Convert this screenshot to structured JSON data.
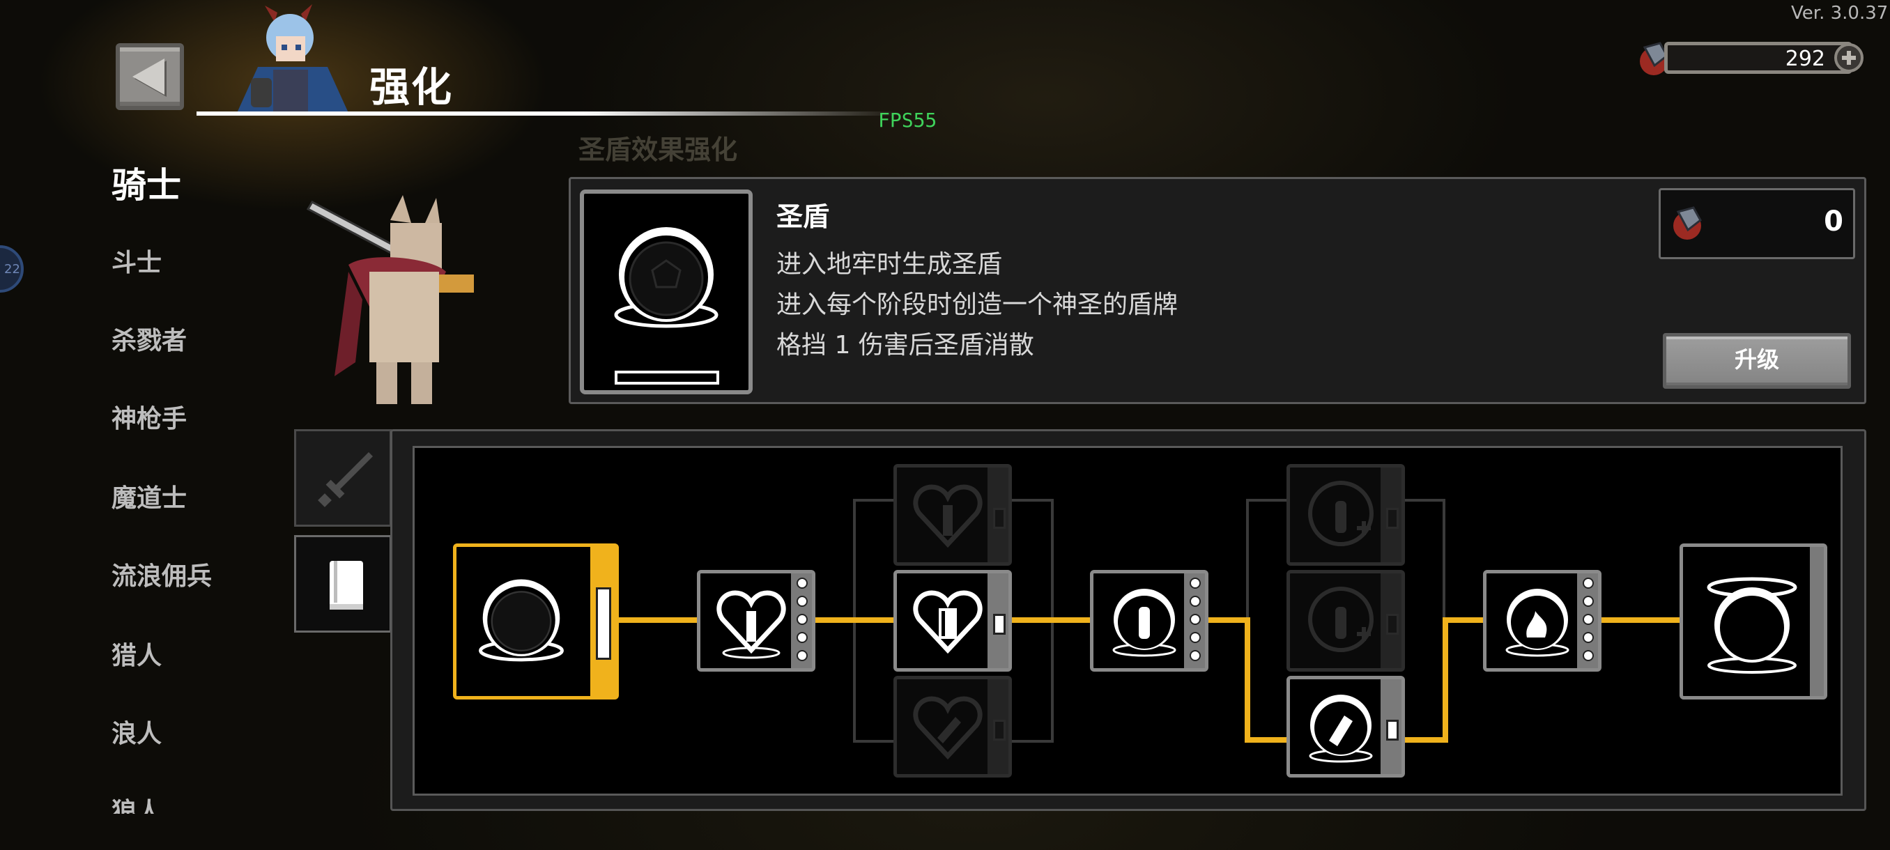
{
  "version": "Ver. 3.0.37",
  "header": {
    "title": "强化",
    "fps": "FPS55",
    "faded_label": "圣盾效果强化"
  },
  "currency": {
    "amount": "292"
  },
  "edge_badge": "22",
  "classes": [
    {
      "label": "骑士",
      "active": true
    },
    {
      "label": "斗士"
    },
    {
      "label": "杀戮者"
    },
    {
      "label": "神枪手"
    },
    {
      "label": "魔道士"
    },
    {
      "label": "流浪佣兵"
    },
    {
      "label": "猎人"
    },
    {
      "label": "浪人"
    },
    {
      "label": "狼人"
    }
  ],
  "skill": {
    "name": "圣盾",
    "desc": [
      "进入地牢时生成圣盾",
      "进入每个阶段时创造一个神圣的盾牌",
      "格挡 1 伤害后圣盾消散"
    ],
    "cost": "0",
    "upgrade_label": "升级"
  },
  "tabs": [
    {
      "name": "sword-icon"
    },
    {
      "name": "book-icon"
    }
  ],
  "colors": {
    "accent": "#f0b21c",
    "panel": "#1c1c1c",
    "node_border": "#8a8a8a"
  },
  "tree_nodes": [
    "holy-shield-root",
    "heart-shield-upper",
    "heart-shield-mid",
    "heart-shield-lower",
    "shield-orb",
    "shield-orb-plus-upper",
    "shield-orb-plus-mid",
    "shield-orb-broken",
    "shield-flame",
    "shield-moon-final"
  ]
}
